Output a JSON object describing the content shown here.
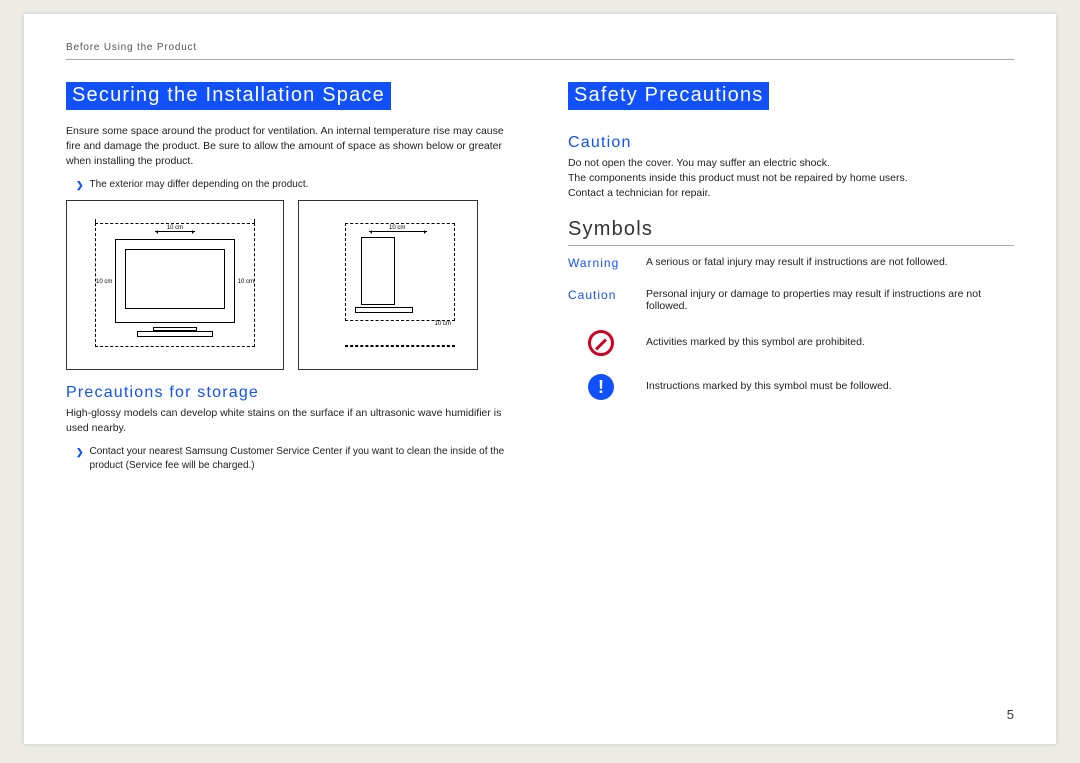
{
  "chapter": "Before Using the Product",
  "page_number": "5",
  "left": {
    "heading": "Securing the Installation Space",
    "intro": "Ensure some space around the product for ventilation. An internal temperature rise may cause fire and damage the product. Be sure to allow the amount of space as shown below or greater when installing the product.",
    "bullet1": "The exterior may differ depending on the product.",
    "fig_labels": {
      "top": "10 cm",
      "left": "10 cm",
      "right": "10 cm",
      "bottom": "10 cm"
    },
    "storage_heading": "Precautions for storage",
    "storage_text": "High-glossy models can develop white stains on the surface if an ultrasonic wave humidifier is used nearby.",
    "storage_bullet": "Contact your nearest Samsung Customer Service Center if you want to clean the inside of the product (Service fee will be charged.)"
  },
  "right": {
    "heading": "Safety Precautions",
    "caution_heading": "Caution",
    "caution_body": "Do not open the cover. You may suffer an electric shock.\nThe components inside this product must not be repaired by home users.\nContact a technician for repair.",
    "symbols_heading": "Symbols",
    "rows": {
      "warning_label": "Warning",
      "warning_desc": "A serious or fatal injury may result if instructions are not followed.",
      "caution_label": "Caution",
      "caution_desc": "Personal injury or damage to properties may result if instructions are not followed.",
      "prohibit_desc": "Activities marked by this symbol are prohibited.",
      "follow_desc": "Instructions marked by this symbol must be followed."
    }
  }
}
